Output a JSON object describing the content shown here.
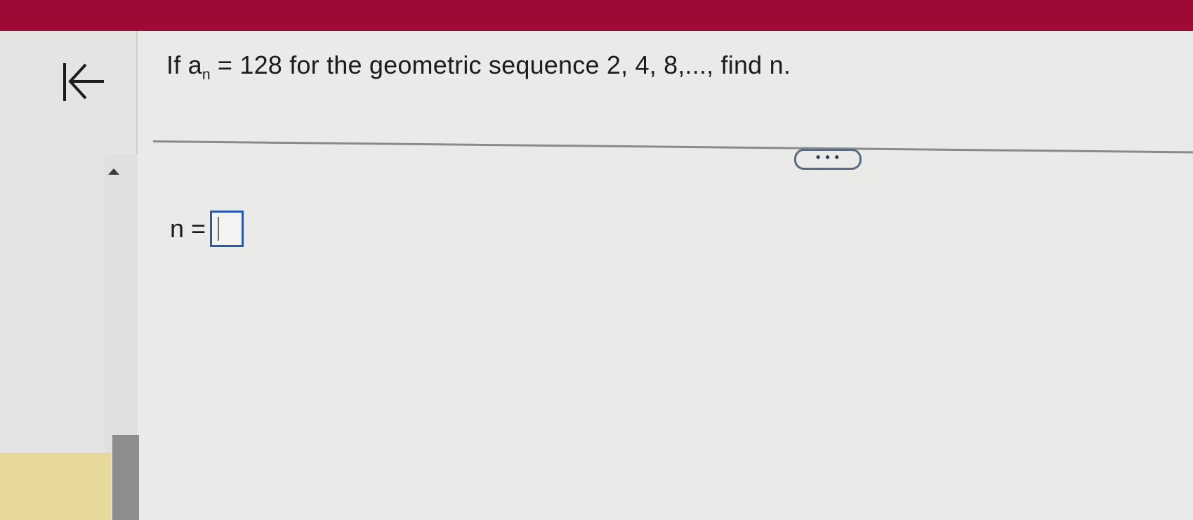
{
  "header": {
    "brand_color": "#9c0a35"
  },
  "navigation": {
    "first_icon": "arrow-to-first-icon"
  },
  "question": {
    "prefix": "If a",
    "subscript": "n",
    "suffix": " = 128 for the geometric sequence 2, 4, 8,..., find n."
  },
  "toolbar": {
    "more_label": "• • •"
  },
  "answer": {
    "label": "n =",
    "value": ""
  }
}
